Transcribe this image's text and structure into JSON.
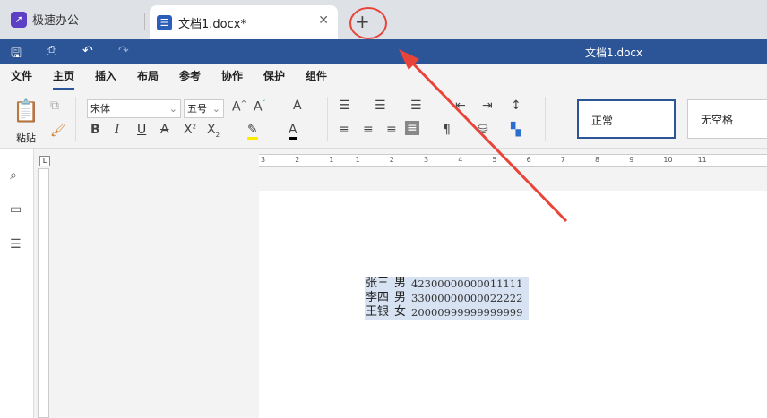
{
  "tabs": [
    {
      "label": "极速办公"
    },
    {
      "label": "文档1.docx*"
    }
  ],
  "doc_title": "文档1.docx",
  "menu": [
    "文件",
    "主页",
    "插入",
    "布局",
    "参考",
    "协作",
    "保护",
    "组件"
  ],
  "ribbon": {
    "paste": "粘贴",
    "font": "宋体",
    "size": "五号",
    "styles": [
      "正常",
      "无空格"
    ]
  },
  "ruler_labels": [
    "3",
    "2",
    "1",
    "1",
    "2",
    "3",
    "4",
    "5",
    "6",
    "7",
    "8",
    "9",
    "10",
    "11"
  ],
  "document": {
    "rows": [
      {
        "name": "张三",
        "gender": "男",
        "id": "42300000000011111"
      },
      {
        "name": "李四",
        "gender": "男",
        "id": "33000000000022222"
      },
      {
        "name": "王银",
        "gender": "女",
        "id": "20000999999999999"
      }
    ]
  },
  "annotation_color": "#e8443a"
}
